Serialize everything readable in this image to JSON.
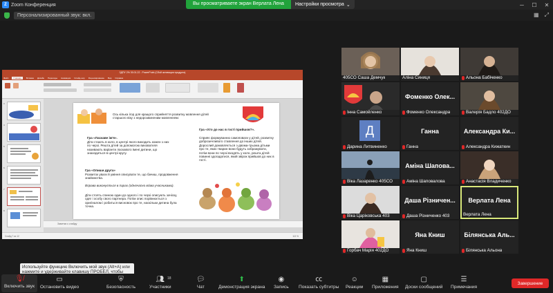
{
  "titlebar": {
    "app_title": "Zoom Конференция",
    "logo_text": "Z"
  },
  "share_banner": {
    "viewing_text": "Вы просматриваете экран Верлата Лена",
    "view_settings": "Настройки просмотра"
  },
  "statusbar": {
    "audio_label": "Персонализированный звук: вкл."
  },
  "powerpoint": {
    "title": "ЗДПУ 2% 30.01.22 - PowerPoint (Сбой активации продукта)",
    "tabs": [
      "Файл",
      "Главная",
      "Вставка",
      "Дизайн",
      "Переходы",
      "Анимация",
      "Слайд-шоу",
      "Рецензирование",
      "Вид",
      "Справка"
    ],
    "notes_placeholder": "Заметки к слайду",
    "status_left": "Слайд 7 из 12",
    "zoom": "113 %",
    "slide_numbers": [
      "3",
      "4",
      "5",
      "6",
      "7",
      "8",
      "9"
    ],
    "slide": {
      "intro": "Ось кілька ігор для кращого сприйняття розвитку мовлення дітей старшого віку з недорозвиненим мовленням:",
      "game1_title": "Гра «Ласкаве ім'я».",
      "game1_body": "Діти стають в коло, в центрі якого виходить кожен з них по черзі. Решта дітей за допомогою вихователя називають варіанти ласкавого імені дитини, що знаходиться в центрі кругу.",
      "game2_title": "Гра «Опиши друга»",
      "game2_body": "Розвиток уваги й уміння описувати те, що бачиш, продовження знайомства.",
      "game2_body2": "Вправа виконується в парах (одночасно всіма учасниками).",
      "game2_body3": "Діти стоять спиною один до одного і по черзі описують зачіску, одяг і особу свого партнера. Потім опис порівнюється з оригіналом і робиться висновок про те, наскільки дитина була точна.",
      "game3_title": "Гра «Хто до нас в гості прийшов?».",
      "game3_body": "Сприяє формуванню самоповаги у дітей, розвитку доброзичливого ставлення до інших дітей. Дорослий домовляється з двома-трьома дітьми про те, яких тварин вони будуть зображувати, потім вони по черзі входять у коло, решта дітей повинні здогадатися, який звірок прийшов до них в гості."
    }
  },
  "gallery": {
    "tiles": [
      {
        "name": "405СО Саша Демчук",
        "big": "",
        "muted": false,
        "video": true
      },
      {
        "name": "Аліна Синиця",
        "big": "",
        "muted": false,
        "video": true
      },
      {
        "name": "Альона Бабіченко",
        "big": "",
        "muted": true,
        "video": true
      },
      {
        "name": "Інна Самойленко",
        "big": "",
        "muted": true,
        "video": true
      },
      {
        "name": "Фоменко Олександра",
        "big": "Фоменко Олек...",
        "muted": true,
        "video": false
      },
      {
        "name": "Валерія Бадло 402ДО",
        "big": "",
        "muted": true,
        "video": true
      },
      {
        "name": "Дарина Литвиненко",
        "big": "",
        "muted": true,
        "video": false
      },
      {
        "name": "Ганна",
        "big": "Ганна",
        "muted": true,
        "video": false
      },
      {
        "name": "Александра Кижаткин",
        "big": "Александра Ки...",
        "muted": true,
        "video": false
      },
      {
        "name": "Віка Лазаренко 405СО",
        "big": "",
        "muted": true,
        "video": true
      },
      {
        "name": "Амінa Шаповалова",
        "big": "Аміна Шапова...",
        "muted": true,
        "video": false
      },
      {
        "name": "Анастасія Владиченко",
        "big": "",
        "muted": true,
        "video": true
      },
      {
        "name": "Віка Царіковська 403",
        "big": "",
        "muted": true,
        "video": true
      },
      {
        "name": "Даша Різниченко 403",
        "big": "Даша Різничен...",
        "muted": true,
        "video": false
      },
      {
        "name": "Верлата Лена",
        "big": "Верлата Лена",
        "muted": false,
        "video": false
      },
      {
        "name": "Горбач Марія 402ДО",
        "big": "",
        "muted": true,
        "video": true
      },
      {
        "name": "Яна Книш",
        "big": "Яна Книш",
        "muted": true,
        "video": false
      },
      {
        "name": "Білянська Альона",
        "big": "Білянська Аль...",
        "muted": true,
        "video": false
      }
    ],
    "avatar_letter": "Д"
  },
  "tooltip": {
    "text": "Используйте функцию Включить мой звук (Alt+A) или нажмите и удерживайте клавишу ПРОБЕЛ, чтобы временно включить звук."
  },
  "toolbar": {
    "unmute": "Включить звук",
    "stop_video": "Остановить видео",
    "security": "Безопасность",
    "participants": "Участники",
    "participants_count": "18",
    "chat": "Чат",
    "share_screen": "Демонстрация экрана",
    "record": "Запись",
    "captions": "Показать субтитры",
    "reactions": "Реакции",
    "apps": "Приложения",
    "whiteboards": "Доски сообщений",
    "notes": "Примечания",
    "end": "Завершение"
  },
  "colors": {
    "accent_green": "#21a33b",
    "end_red": "#e02828",
    "active_speaker": "#d9e97b",
    "ppt_brand": "#b7472a"
  }
}
